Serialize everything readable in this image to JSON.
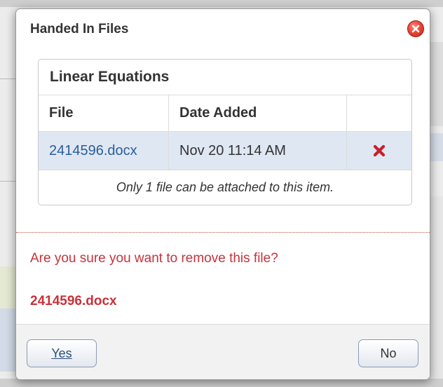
{
  "dialog": {
    "title": "Handed In Files",
    "close_icon": "close-circle-icon"
  },
  "files_table": {
    "caption": "Linear Equations",
    "columns": [
      "File",
      "Date Added",
      ""
    ],
    "rows": [
      {
        "file": "2414596.docx",
        "date_added": "Nov 20 11:14 AM",
        "action_icon": "delete-x-icon"
      }
    ],
    "note": "Only 1 file can be attached to this item."
  },
  "confirmation": {
    "question": "Are you sure you want to remove this file?",
    "file_name": "2414596.docx"
  },
  "buttons": {
    "yes_label": "Yes",
    "no_label": "No"
  },
  "colors": {
    "confirm_text": "#c8323a",
    "row_highlight": "#dfe7f3",
    "link": "#2a5d9c",
    "delete_icon": "#c8202a"
  }
}
